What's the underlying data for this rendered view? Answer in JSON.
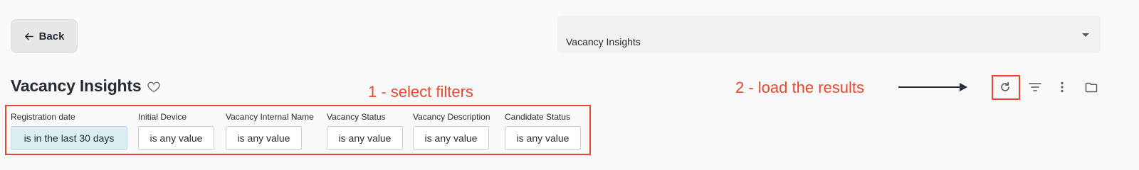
{
  "header": {
    "back_label": "Back",
    "dashboard_select_value": "Vacancy Insights"
  },
  "page": {
    "title": "Vacancy Insights"
  },
  "annotations": {
    "select_filters": "1 - select filters",
    "load_results": "2 - load the results",
    "color": "#e8472d"
  },
  "toolbar": {
    "icons": [
      "refresh-icon",
      "filter-icon",
      "more-vert-icon",
      "folder-icon"
    ]
  },
  "filters": [
    {
      "label": "Registration date",
      "value": "is in the last 30 days",
      "active": true
    },
    {
      "label": "Initial Device",
      "value": "is any value",
      "active": false
    },
    {
      "label": "Vacancy Internal Name",
      "value": "is any value",
      "active": false
    },
    {
      "label": "Vacancy Status",
      "value": "is any value",
      "active": false
    },
    {
      "label": "Vacancy Description",
      "value": "is any value",
      "active": false
    },
    {
      "label": "Candidate Status",
      "value": "is any value",
      "active": false
    }
  ],
  "colors": {
    "background": "#f8f9f8",
    "active_chip": "#daeef3",
    "text": "#262d34"
  }
}
